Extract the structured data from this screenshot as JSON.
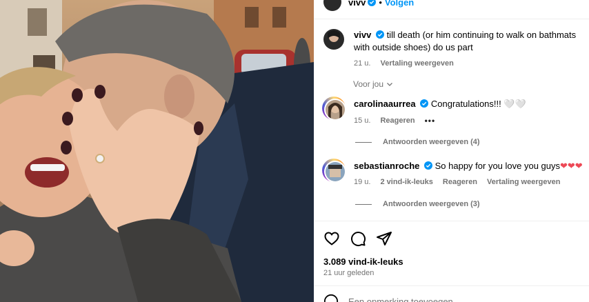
{
  "post": {
    "author": "vivv",
    "follow_label": "Volgen",
    "caption": {
      "username": "vivv",
      "text": "till death (or him continuing to walk on bathmats with outside shoes) do us part",
      "time": "21 u.",
      "translate_label": "Vertaling weergeven"
    },
    "sort_label": "Voor jou",
    "likes": "3.089 vind-ik-leuks",
    "posted_ago": "21 uur geleden",
    "comment_placeholder": "Een opmerking toevoegen..."
  },
  "comments": [
    {
      "username": "carolinaaurrea",
      "text": "Congratulations!!! 🤍🤍",
      "time": "15 u.",
      "reply_label": "Reageren",
      "more": "•••",
      "view_replies": "Antwoorden weergeven (4)"
    },
    {
      "username": "sebastianroche",
      "text": "So happy for you love you guys",
      "hearts": "❤❤❤",
      "time": "19 u.",
      "likes": "2 vind-ik-leuks",
      "reply_label": "Reageren",
      "translate_label": "Vertaling weergeven",
      "view_replies": "Antwoorden weergeven (3)"
    }
  ],
  "icons": [
    "heart-icon",
    "comment-icon",
    "share-icon",
    "verified-icon",
    "chevron-down-icon",
    "emoji-icon"
  ],
  "colors": {
    "link": "#0095f6",
    "muted": "#737373",
    "verified": "#0095f6",
    "heart": "#ed4956"
  }
}
